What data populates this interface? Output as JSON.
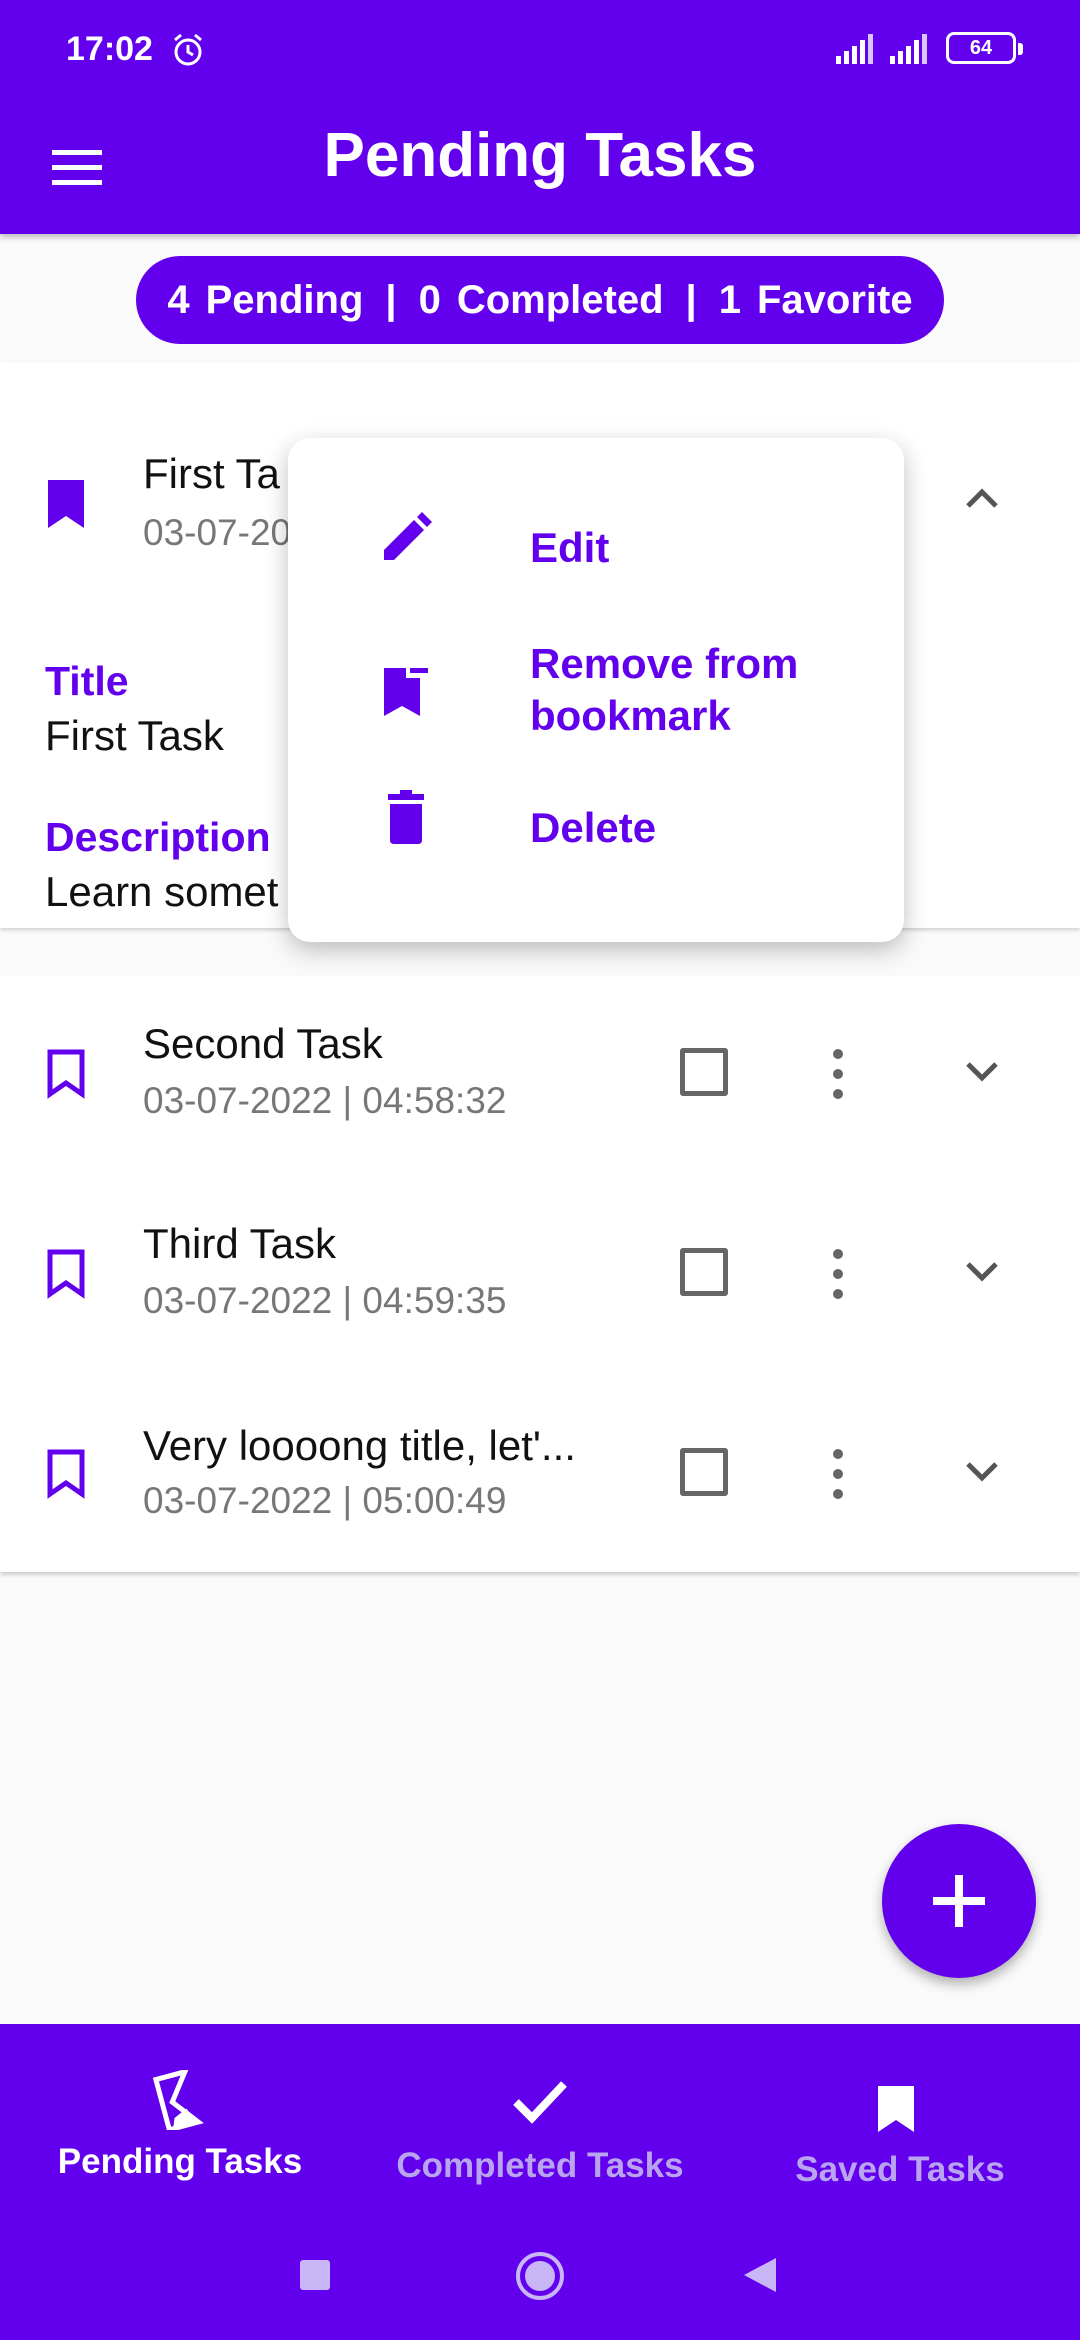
{
  "status": {
    "time": "17:02",
    "battery": "64"
  },
  "appbar": {
    "title": "Pending Tasks"
  },
  "summary": {
    "pending_count": "4",
    "pending_label": "Pending",
    "sep1": "|",
    "completed_count": "0",
    "completed_label": "Completed",
    "sep2": "|",
    "favorite_count": "1",
    "favorite_label": "Favorite"
  },
  "expanded_task": {
    "name": "First Ta",
    "date": "03-07-20",
    "title_label": "Title",
    "title_value": "First Task",
    "description_label": "Description",
    "description_value": "Learn somet"
  },
  "tasks": [
    {
      "name": "Second Task",
      "date": "03-07-2022  |  04:58:32"
    },
    {
      "name": "Third Task",
      "date": "03-07-2022  |  04:59:35"
    },
    {
      "name": "Very loooong title, let'...",
      "date": "03-07-2022  |  05:00:49"
    }
  ],
  "popup_menu": {
    "edit": "Edit",
    "remove_bookmark": "Remove from bookmark",
    "delete": "Delete"
  },
  "bottom_nav": {
    "pending": "Pending Tasks",
    "completed": "Completed Tasks",
    "saved": "Saved Tasks"
  },
  "colors": {
    "primary": "#6200ee",
    "inactive_nav": "#b9a4f0"
  }
}
